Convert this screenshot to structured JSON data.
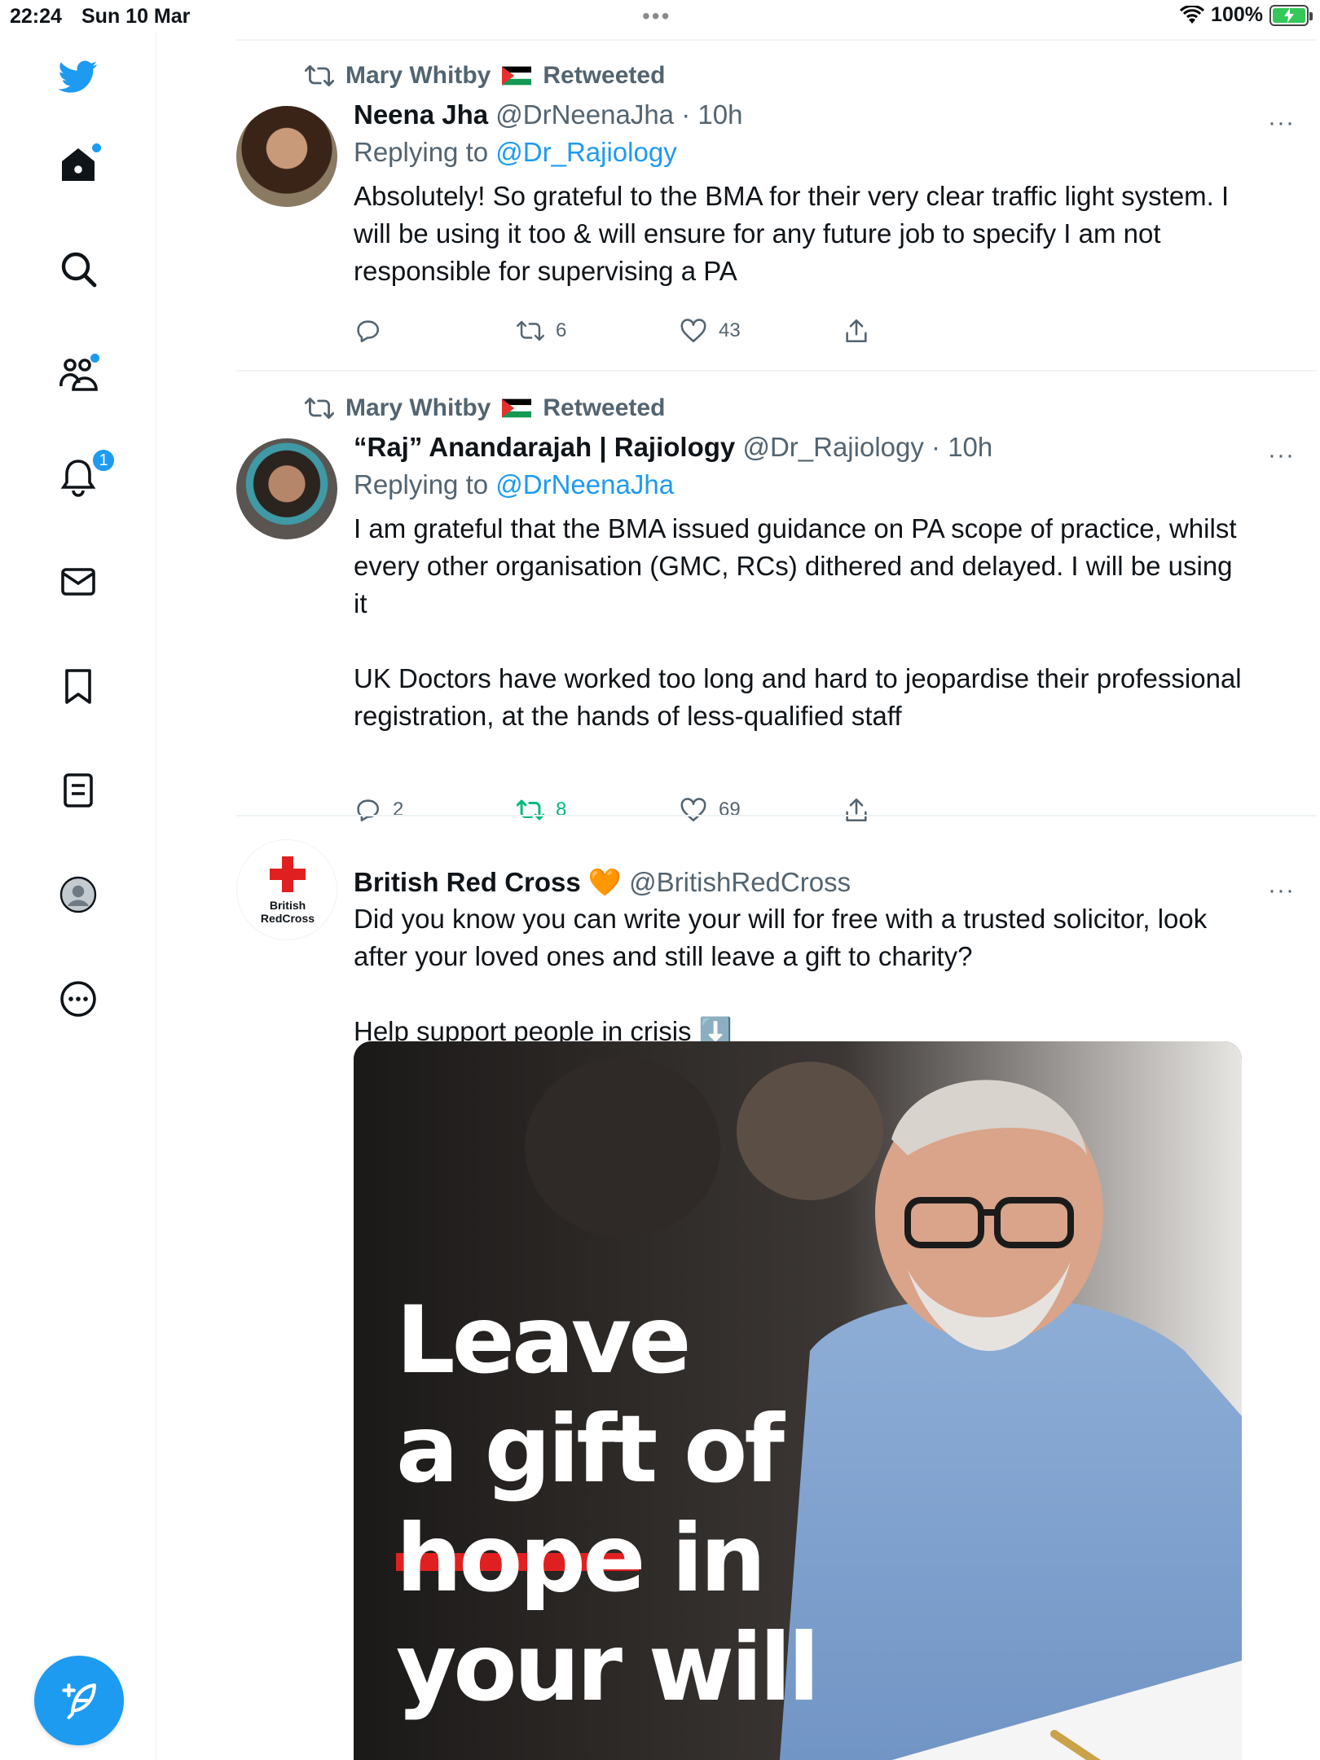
{
  "status_bar": {
    "time": "22:24",
    "date": "Sun 10 Mar",
    "dots": "•••",
    "battery": "100%"
  },
  "sidebar": {
    "items": [
      {
        "icon": "twitter-bird-icon"
      },
      {
        "icon": "home-icon",
        "dot": true
      },
      {
        "icon": "search-icon"
      },
      {
        "icon": "communities-icon",
        "dot": true
      },
      {
        "icon": "notifications-icon",
        "badge": "1"
      },
      {
        "icon": "messages-icon"
      },
      {
        "icon": "bookmarks-icon"
      },
      {
        "icon": "lists-icon"
      },
      {
        "icon": "profile-icon"
      },
      {
        "icon": "more-icon"
      }
    ],
    "compose_icon": "compose-tweet-icon",
    "accent": "#1d9bf0"
  },
  "tweets": [
    {
      "retweeted_by": "Mary Whitby",
      "retweeted_label": "Retweeted",
      "name": "Neena Jha",
      "handle": "@DrNeenaJha",
      "time": "· 10h",
      "replying_label": "Replying to",
      "replying_to": "@Dr_Rajiology",
      "text": "Absolutely! So grateful to the BMA for their very clear traffic light system. I will be using it too & will ensure for any future job to specify I am not responsible for supervising a PA",
      "replies": "",
      "retweets": "6",
      "likes": "43"
    },
    {
      "retweeted_by": "Mary Whitby",
      "retweeted_label": "Retweeted",
      "name": "“Raj” Anandarajah | Rajiology",
      "handle": "@Dr_Rajiology",
      "time": "· 10h",
      "replying_label": "Replying to",
      "replying_to": "@DrNeenaJha",
      "text": "I am grateful that the BMA issued guidance on PA scope of practice, whilst every other organisation (GMC, RCs) dithered and delayed. I will be using it\n\nUK Doctors have worked too long and hard to jeopardise their professional registration, at the hands of less-qualified staff",
      "replies": "2",
      "retweets": "8",
      "likes": "69"
    },
    {
      "name": "British Red Cross",
      "handle": "@BritishRedCross",
      "avatar_text_1": "British",
      "avatar_text_2": "RedCross",
      "text": "Did you know you can write your will for free with a trusted solicitor, look after your loved ones and still leave a gift to charity?\n\nHelp support people in crisis ⬇️",
      "promo_lines": [
        "Leave",
        "a gift of",
        "hope in",
        "your will"
      ]
    }
  ],
  "colors": {
    "accent": "#1d9bf0",
    "retweet_green": "#00ba7c",
    "secondary_text": "#536471",
    "red_cross": "#e02020"
  }
}
